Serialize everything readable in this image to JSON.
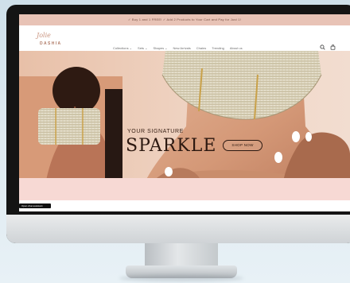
{
  "site": {
    "announcement": "✓ Buy 1 and 1 FREE! ✓ Add 2 Products to Your Cart and Pay for Just 1!",
    "logo_script": "Jolie",
    "logo_word": "DASHIA",
    "nav": [
      "Collections ⌄",
      "Sets ⌄",
      "Shapes ⌄",
      "New Arrivals",
      "Chains",
      "Trending",
      "About us"
    ],
    "hero": {
      "eyebrow": "YOUR SIGNATURE",
      "headline": "SPARKLE",
      "cta": "SHOP NOW"
    },
    "tooltip": "Open chat assistant"
  },
  "colors": {
    "announce_bg": "#e8c3b6",
    "hero_bg": "#d8a182",
    "pink_strip": "#f7d9d4",
    "text_dark": "#2c1810"
  },
  "icons": [
    "search-icon",
    "cart-icon"
  ]
}
